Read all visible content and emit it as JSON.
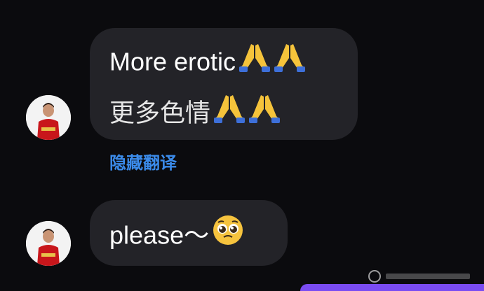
{
  "messages": [
    {
      "lines": [
        "More erotic",
        "更多色情"
      ],
      "line_emoji": [
        "folded-hands-icon",
        "folded-hands-icon"
      ]
    },
    {
      "lines": [
        "please～"
      ],
      "line_emoji": [
        "pleading-face-icon"
      ]
    }
  ],
  "translation_toggle": "隐藏翻译",
  "colors": {
    "background": "#0b0b0e",
    "bubble": "#232328",
    "text": "#ffffff",
    "link": "#3b8bea",
    "accent": "#7a4cf2"
  }
}
